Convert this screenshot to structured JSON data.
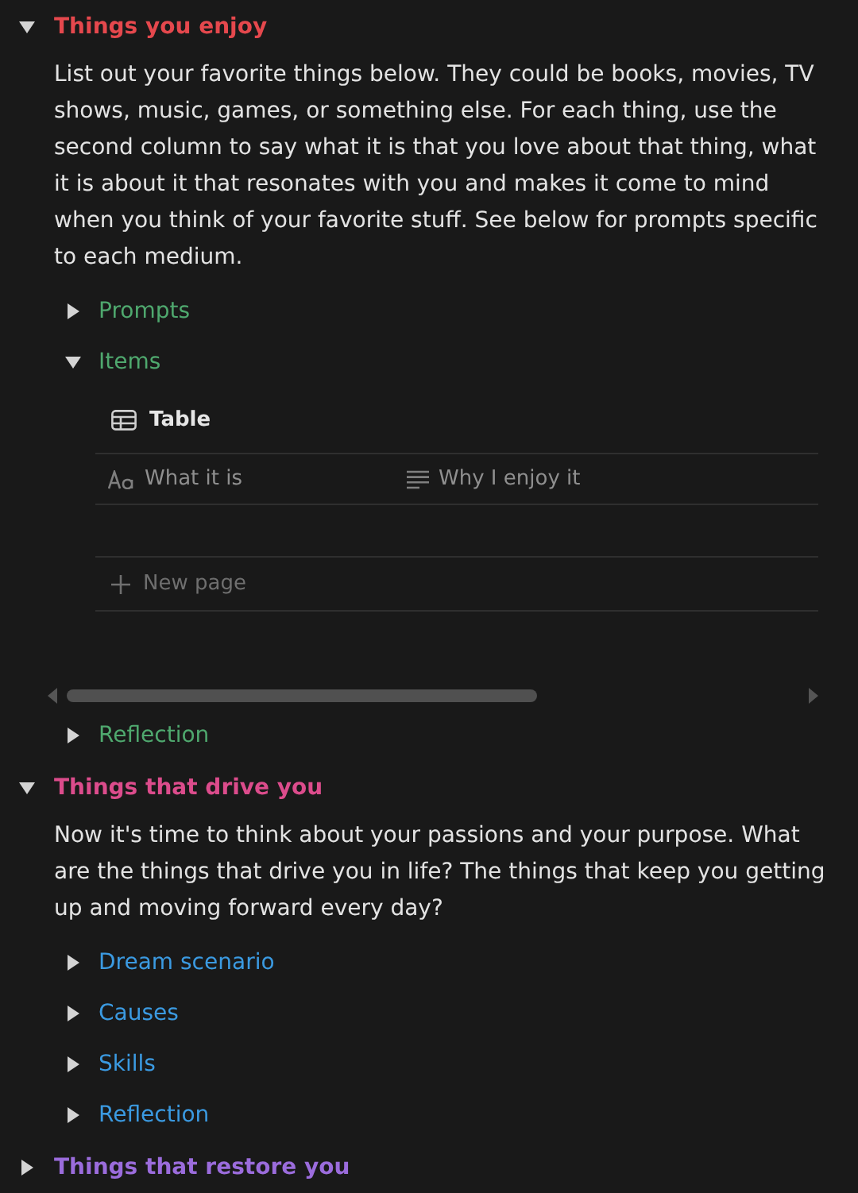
{
  "sections": [
    {
      "title": "Things you enjoy",
      "color": "#e5484d",
      "expanded": true,
      "description": "List out your favorite things below. They could be books, movies, TV shows, music, games, or something else. For each thing, use the second column to say what it is that you love about that thing, what it is about it that resonates with you and makes it come to mind when you think of your favorite stuff. See below for prompts specific to each medium.",
      "toggles": [
        {
          "label": "Prompts",
          "color": "#4fa86e",
          "expanded": false
        },
        {
          "label": "Items",
          "color": "#4fa86e",
          "expanded": true,
          "table": {
            "title": "Table",
            "columns": [
              {
                "label": "What it is",
                "kind": "title"
              },
              {
                "label": "Why I enjoy it",
                "kind": "text"
              }
            ],
            "new_row": "New page"
          }
        },
        {
          "label": "Reflection",
          "color": "#4fa86e",
          "expanded": false
        }
      ]
    },
    {
      "title": "Things that drive you",
      "color": "#dc4c8c",
      "expanded": true,
      "description": "Now it's time to think about your passions and your purpose. What are the things that drive you in life? The things that keep you getting up and moving forward every day?",
      "toggles": [
        {
          "label": "Dream scenario",
          "color": "#3b9ae1",
          "expanded": false
        },
        {
          "label": "Causes",
          "color": "#3b9ae1",
          "expanded": false
        },
        {
          "label": "Skills",
          "color": "#3b9ae1",
          "expanded": false
        },
        {
          "label": "Reflection",
          "color": "#3b9ae1",
          "expanded": false
        }
      ]
    },
    {
      "title": "Things that restore you",
      "color": "#9b6cdc",
      "expanded": false
    }
  ]
}
